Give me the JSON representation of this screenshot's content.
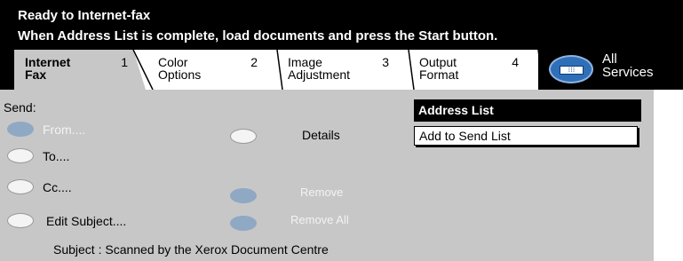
{
  "header": {
    "status_line1": "Ready to Internet-fax",
    "status_line2": "When Address List is complete, load documents and press the Start button."
  },
  "tabs": [
    {
      "line1": "Internet",
      "line2": "Fax",
      "number": "1",
      "active": true
    },
    {
      "line1": "Color",
      "line2": "Options",
      "number": "2",
      "active": false
    },
    {
      "line1": "Image",
      "line2": "Adjustment",
      "number": "3",
      "active": false
    },
    {
      "line1": "Output",
      "line2": "Format",
      "number": "4",
      "active": false
    }
  ],
  "all_services": {
    "line1": "All",
    "line2": "Services",
    "icon": "keypad-icon"
  },
  "send": {
    "label": "Send:",
    "from": "From....",
    "to": "To....",
    "cc": "Cc....",
    "edit_subject": "Edit Subject...."
  },
  "actions": {
    "details": "Details",
    "remove": "Remove",
    "remove_all": "Remove All"
  },
  "address_list": {
    "title": "Address List",
    "items": [
      "Add to Send List"
    ]
  },
  "subject_line": "Subject : Scanned by the Xerox Document Centre",
  "colors": {
    "header_bg": "#000000",
    "panel_bg": "#c7c7c7",
    "pill_disabled": "#8fa8c4",
    "services_blue": "#2f6fb8"
  }
}
